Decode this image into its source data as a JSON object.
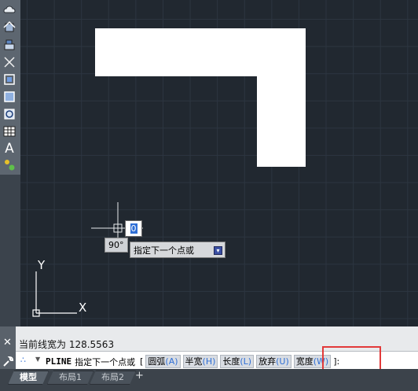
{
  "dynamic_input": {
    "angle": "90°",
    "coord_value": "0",
    "prompt": "指定下一个点或",
    "prompt_toggle_icon": "down-arrow-icon"
  },
  "axes": {
    "y_label": "Y",
    "x_label": "X"
  },
  "command": {
    "history": "当前线宽为 128.5563",
    "name": "PLINE",
    "prompt": "指定下一个点或",
    "open_bracket": "[",
    "options": [
      {
        "label": "圆弧",
        "key": "(A)"
      },
      {
        "label": "半宽",
        "key": "(H)"
      },
      {
        "label": "长度",
        "key": "(L)"
      },
      {
        "label": "放弃",
        "key": "(U)"
      },
      {
        "label": "宽度",
        "key": "(W)"
      }
    ],
    "suffix": "]:"
  },
  "tabs": [
    {
      "label": "模型",
      "active": true
    },
    {
      "label": "布局1",
      "active": false
    },
    {
      "label": "布局2",
      "active": false
    }
  ],
  "tab_add": "+",
  "toolbar_text_tool": "A",
  "colors": {
    "canvas": "#212830",
    "drawn_shape": "#ffffff",
    "highlight": "#e23a3a",
    "option_key": "#2f6fd6"
  }
}
